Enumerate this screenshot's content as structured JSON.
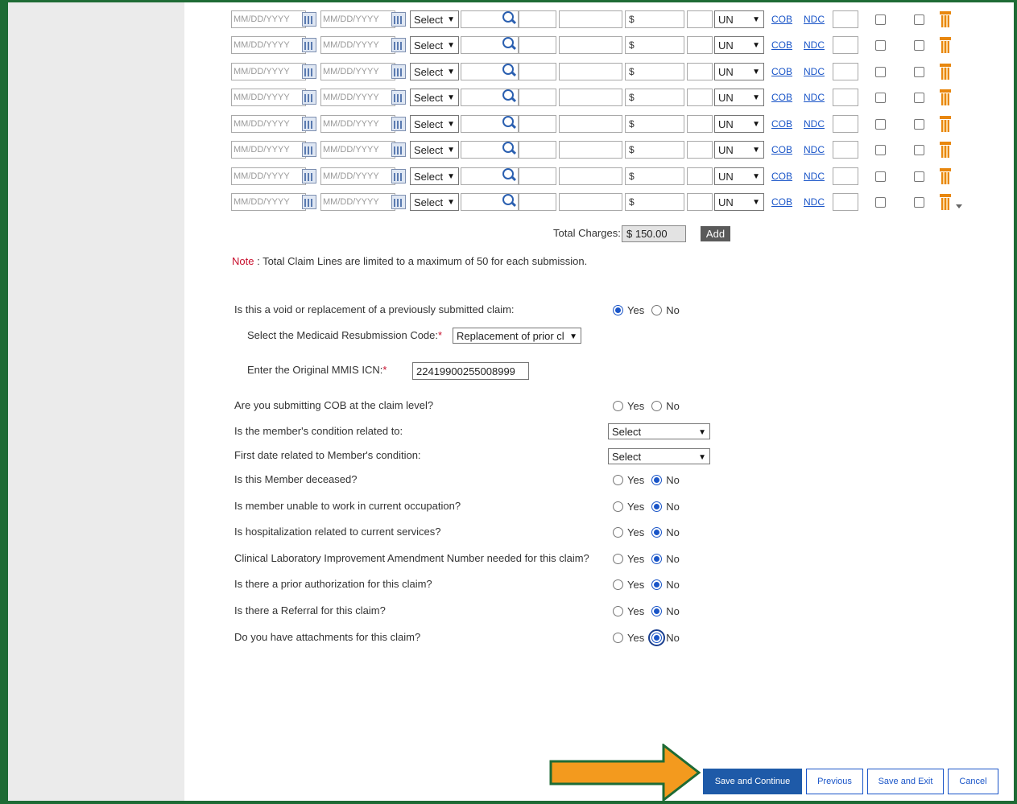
{
  "claim_lines": {
    "date_placeholder": "MM/DD/YYYY",
    "select_label": "Select",
    "dollar_sign": "$",
    "unit_value": "UN",
    "cob_link": "COB",
    "ndc_link": "NDC",
    "row_count": 8
  },
  "totals": {
    "label": "Total Charges:",
    "value": "$ 150.00",
    "add_button": "Add"
  },
  "note": {
    "key": "Note",
    "text": " : Total Claim Lines are limited to a maximum of 50 for each submission."
  },
  "questions": {
    "void_replacement": {
      "label": "Is this a void or replacement of a previously submitted claim:",
      "yes": "Yes",
      "no": "No",
      "selected": "Yes"
    },
    "resubmission_code": {
      "label": "Select the Medicaid Resubmission Code:",
      "required": "*",
      "value": "Replacement of prior cl"
    },
    "original_icn": {
      "label": "Enter the Original MMIS ICN:",
      "required": "*",
      "value": "22419900255008999"
    },
    "cob_claim_level": {
      "label": "Are you submitting COB at the claim level?",
      "yes": "Yes",
      "no": "No",
      "selected": ""
    },
    "condition_related": {
      "label": "Is the member's condition related to:",
      "value": "Select"
    },
    "first_date_condition": {
      "label": "First date related to Member's condition:",
      "value": "Select"
    },
    "member_deceased": {
      "label": "Is this Member deceased?",
      "yes": "Yes",
      "no": "No",
      "selected": "No"
    },
    "unable_to_work": {
      "label": "Is member unable to work in current occupation?",
      "yes": "Yes",
      "no": "No",
      "selected": "No"
    },
    "hospitalization": {
      "label": "Is hospitalization related to current services?",
      "yes": "Yes",
      "no": "No",
      "selected": "No"
    },
    "clia_number": {
      "label": "Clinical Laboratory Improvement Amendment Number needed for this claim?",
      "yes": "Yes",
      "no": "No",
      "selected": "No"
    },
    "prior_authorization": {
      "label": "Is there a prior authorization for this claim?",
      "yes": "Yes",
      "no": "No",
      "selected": "No"
    },
    "referral": {
      "label": "Is there a Referral for this claim?",
      "yes": "Yes",
      "no": "No",
      "selected": "No"
    },
    "attachments": {
      "label": "Do you have attachments for this claim?",
      "yes": "Yes",
      "no": "No",
      "selected": "No"
    }
  },
  "buttons": {
    "save_continue": "Save and Continue",
    "previous": "Previous",
    "save_exit": "Save and Exit",
    "cancel": "Cancel"
  },
  "colors": {
    "frame_green": "#1e6b35",
    "arrow_orange": "#f39a1e",
    "primary_blue": "#1e5aa8",
    "required_red": "#c8102e"
  }
}
